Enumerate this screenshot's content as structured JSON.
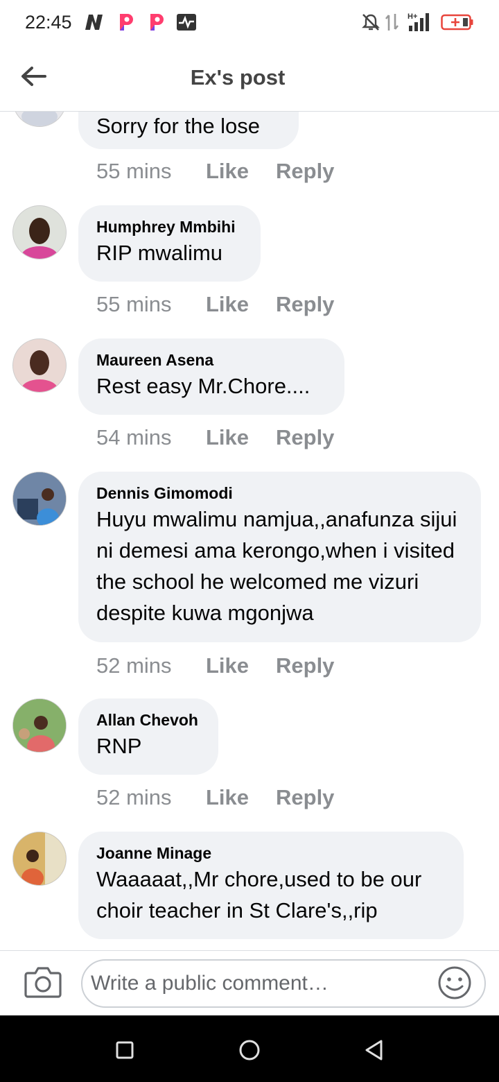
{
  "status_bar": {
    "time": "22:45",
    "left_icons": [
      "netflix-n-icon",
      "pinterest-p-icon",
      "pinterest-p-icon",
      "activity-icon"
    ],
    "right_icons": [
      "mute-bell-icon",
      "data-arrows-icon",
      "signal-hplus-icon",
      "battery-charging-icon"
    ],
    "network_label": "H+"
  },
  "header": {
    "title": "Ex's post"
  },
  "comments": [
    {
      "author": "",
      "text": "Sorry for the lose",
      "time": "55 mins",
      "like": "Like",
      "reply": "Reply"
    },
    {
      "author": "Humphrey Mmbihi",
      "text": "RIP mwalimu",
      "time": "55 mins",
      "like": "Like",
      "reply": "Reply"
    },
    {
      "author": "Maureen Asena",
      "text": "Rest easy Mr.Chore....",
      "time": "54 mins",
      "like": "Like",
      "reply": "Reply"
    },
    {
      "author": "Dennis Gimomodi",
      "text": "Huyu mwalimu namjua,,anafunza sijui ni demesi ama kerongo,when i visited the school he welcomed me vizuri despite kuwa mgonjwa",
      "time": "52 mins",
      "like": "Like",
      "reply": "Reply"
    },
    {
      "author": "Allan Chevoh",
      "text": "RNP",
      "time": "52 mins",
      "like": "Like",
      "reply": "Reply"
    },
    {
      "author": "Joanne Minage",
      "text": "Waaaaat,,Mr chore,used to be our choir teacher in St Clare's,,rip",
      "time": "",
      "like": "",
      "reply": ""
    }
  ],
  "composer": {
    "placeholder": "Write a public comment…"
  },
  "colors": {
    "bubble": "#f0f2f5",
    "meta": "#8a8d91",
    "battery": "#e8453c",
    "navbar": "#000000"
  }
}
